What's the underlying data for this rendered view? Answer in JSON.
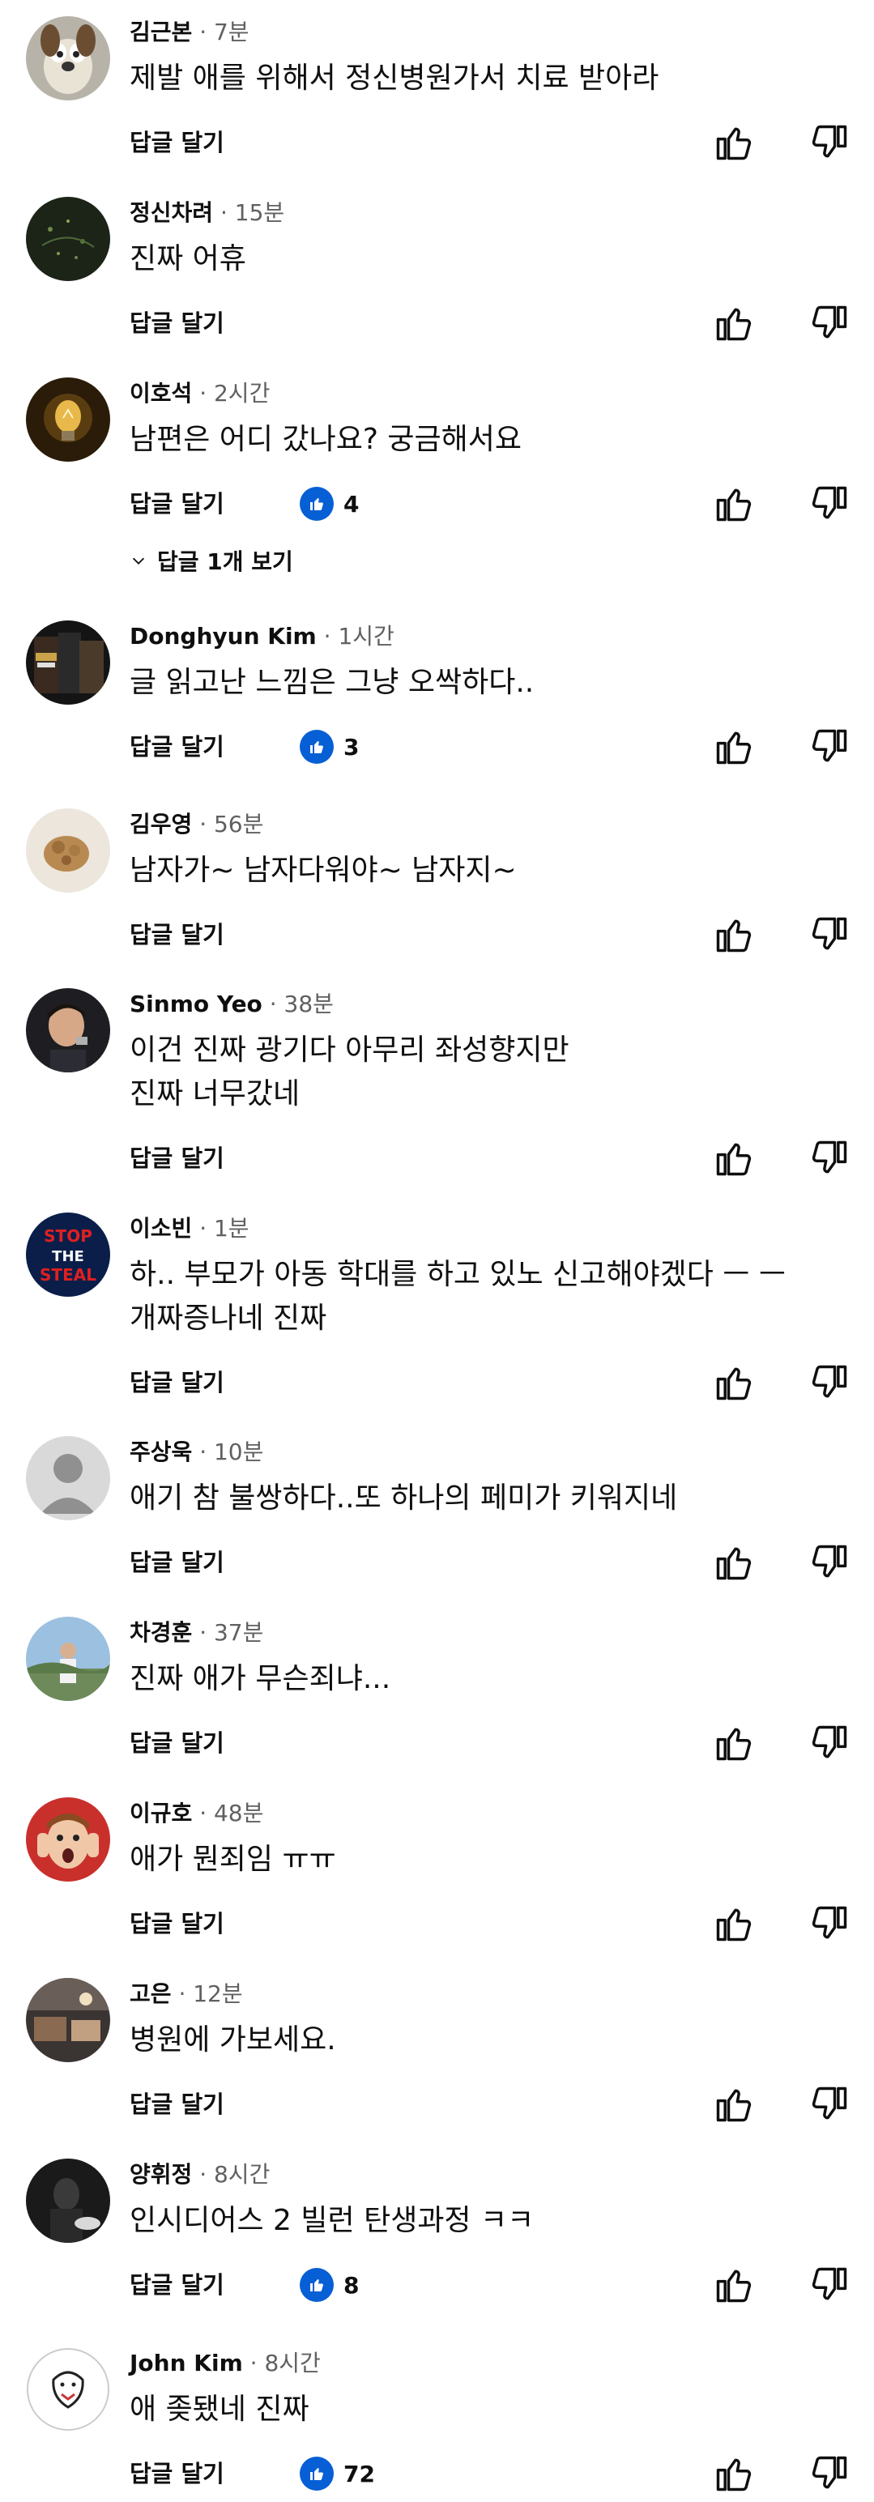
{
  "comments": [
    {
      "author": "김근본",
      "time": "· 7분",
      "lines": [
        "제발 애를 위해서 정신병원가서 치료 받아라"
      ],
      "likes": "",
      "avatar": "gromit"
    },
    {
      "author": "정신차려",
      "time": "· 15분",
      "lines": [
        "진짜 어휴"
      ],
      "likes": "",
      "avatar": "dark-grass"
    },
    {
      "author": "이호석",
      "time": "· 2시간",
      "lines": [
        "남편은 어디 갔나요? 궁금해서요"
      ],
      "likes": "4",
      "avatar": "lightbulb"
    },
    {
      "author": "Donghyun Kim",
      "time": "· 1시간",
      "lines": [
        "글 읽고난 느낌은 그냥 오싹하다.."
      ],
      "likes": "3",
      "avatar": "movie-poster"
    },
    {
      "author": "김우영",
      "time": "· 56분",
      "lines": [
        "남자가~ 남자다워야~ 남자지~"
      ],
      "likes": "",
      "avatar": "food"
    },
    {
      "author": "Sinmo Yeo",
      "time": "· 38분",
      "lines": [
        "이건 진짜 광기다 아무리 좌성향지만",
        "진짜 너무갔네"
      ],
      "likes": "",
      "avatar": "man-portrait"
    },
    {
      "author": "이소빈",
      "time": "· 1분",
      "lines": [
        "하.. 부모가 아동 학대를 하고 있노 신고해야겠다 ㅡ ㅡ",
        "개짜증나네 진짜"
      ],
      "likes": "",
      "avatar": "stop-the-steal"
    },
    {
      "author": "주상욱",
      "time": "· 10분",
      "lines": [
        "애기 참 불쌍하다..또 하나의 페미가 키워지네"
      ],
      "likes": "",
      "avatar": "default-person"
    },
    {
      "author": "차경훈",
      "time": "· 37분",
      "lines": [
        "진짜 애가 무슨죄냐..."
      ],
      "likes": "",
      "avatar": "outdoor-man"
    },
    {
      "author": "이규호",
      "time": "· 48분",
      "lines": [
        "애가 뭔죄임 ㅠㅠ"
      ],
      "likes": "",
      "avatar": "screaming-kid"
    },
    {
      "author": "고은",
      "time": "· 12분",
      "lines": [
        "병원에 가보세요."
      ],
      "likes": "",
      "avatar": "room-interior"
    },
    {
      "author": "양휘정",
      "time": "· 8시간",
      "lines": [
        "인시디어스 2 빌런 탄생과정 ㅋㅋ"
      ],
      "likes": "8",
      "avatar": "dark-figure"
    },
    {
      "author": "John Kim",
      "time": "· 8시간",
      "lines": [
        "애 좆됐네 진짜"
      ],
      "likes": "72",
      "avatar": "doodle"
    }
  ],
  "ui": {
    "reply_label": "답글 달기",
    "view_replies": "답글 1개 보기",
    "avatar_text": {
      "stop_line1": "STOP",
      "stop_line2": "THE",
      "stop_line3": "STEAL"
    }
  },
  "colors": {
    "like_badge": "#065fd4",
    "secondary_text": "#606060",
    "primary_text": "#0f0f0f"
  }
}
